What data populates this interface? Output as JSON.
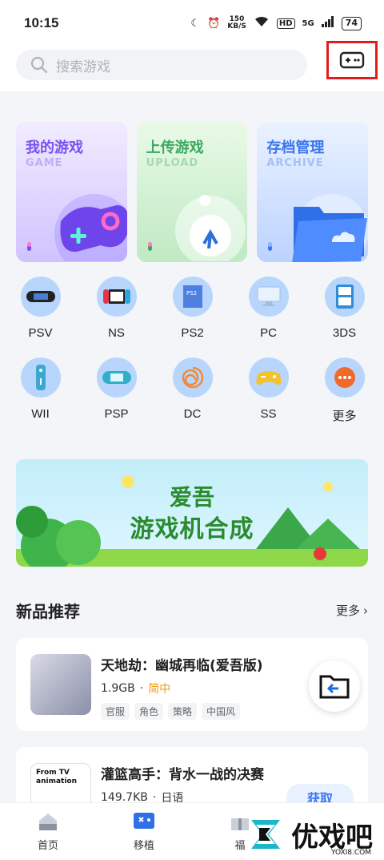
{
  "status": {
    "time": "10:15",
    "net_speed_top": "150",
    "net_speed_bottom": "KB/S",
    "hd": "HD",
    "signal": "5G",
    "battery": "74"
  },
  "search": {
    "placeholder": "搜索游戏"
  },
  "cards": [
    {
      "title": "我的游戏",
      "subtitle": "GAME"
    },
    {
      "title": "上传游戏",
      "subtitle": "UPLOAD"
    },
    {
      "title": "存档管理",
      "subtitle": "ARCHIVE"
    }
  ],
  "platforms": [
    {
      "label": "PSV",
      "icon": "psv-icon"
    },
    {
      "label": "NS",
      "icon": "switch-icon"
    },
    {
      "label": "PS2",
      "icon": "ps2-icon"
    },
    {
      "label": "PC",
      "icon": "monitor-icon"
    },
    {
      "label": "3DS",
      "icon": "3ds-icon"
    },
    {
      "label": "WII",
      "icon": "wii-icon"
    },
    {
      "label": "PSP",
      "icon": "psp-icon"
    },
    {
      "label": "DC",
      "icon": "dreamcast-icon"
    },
    {
      "label": "SS",
      "icon": "saturn-icon"
    },
    {
      "label": "更多",
      "icon": "more-icon"
    }
  ],
  "banner": {
    "line1": "爱吾",
    "line2": "游戏机合成"
  },
  "section": {
    "title": "新品推荐",
    "more": "更多"
  },
  "games": [
    {
      "name": "天地劫：幽城再临(爱吾版)",
      "size": "1.9GB",
      "lang": "简中",
      "tags": [
        "官服",
        "角色",
        "策略",
        "中国风"
      ]
    },
    {
      "name": "灌篮高手：背水一战的决赛",
      "size": "149.7KB",
      "lang": "日语",
      "button": "获取",
      "cover_text": "From TV animation"
    }
  ],
  "nav": [
    {
      "label": "首页"
    },
    {
      "label": "移植"
    },
    {
      "label": "福"
    }
  ],
  "watermark": {
    "text": "优戏吧",
    "url": "YOXI8.COM"
  },
  "colors": {
    "accent": "#3d76ee",
    "highlight_box": "#e31b1b",
    "platform_circle": "#b8d6fb"
  }
}
